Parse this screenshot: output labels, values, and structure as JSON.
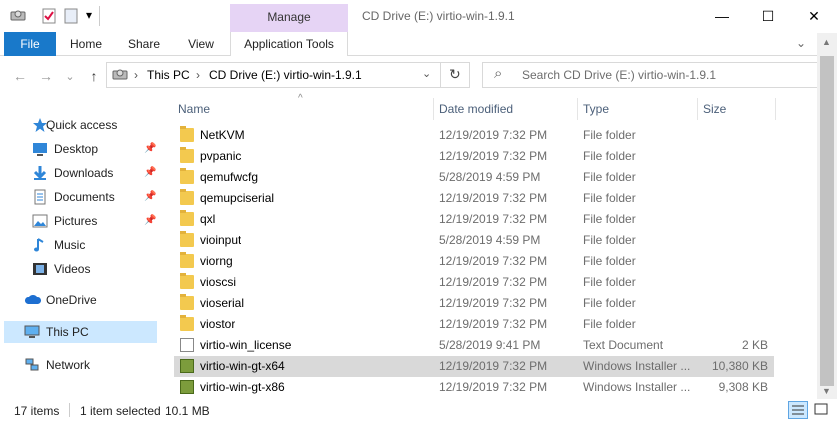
{
  "window": {
    "title": "CD Drive (E:) virtio-win-1.9.1",
    "controls": {
      "minimize": "—",
      "maximize": "☐",
      "close": "✕"
    }
  },
  "quick_access_toolbar": {
    "dropdown_glyph": "▾"
  },
  "ribbon": {
    "context_group_label": "Manage",
    "tabs": [
      "File",
      "Home",
      "Share",
      "View",
      "Application Tools"
    ],
    "expand_icon": "⌄",
    "help_icon": "?"
  },
  "address_bar": {
    "segments": [
      "This PC",
      "CD Drive (E:) virtio-win-1.9.1"
    ],
    "refresh_icon": "↻",
    "dropdown_icon": "⌄"
  },
  "nav_buttons": {
    "back": "←",
    "forward": "→",
    "recent": "⌄",
    "up": "↑"
  },
  "search": {
    "placeholder": "Search CD Drive (E:) virtio-win-1.9.1",
    "icon": "⌕"
  },
  "nav_pane": {
    "items": [
      {
        "label": "Quick access",
        "icon": "star-icon",
        "pinned": false
      },
      {
        "label": "Desktop",
        "icon": "desktop-icon",
        "pinned": true
      },
      {
        "label": "Downloads",
        "icon": "download-icon",
        "pinned": true
      },
      {
        "label": "Documents",
        "icon": "documents-icon",
        "pinned": true
      },
      {
        "label": "Pictures",
        "icon": "pictures-icon",
        "pinned": true
      },
      {
        "label": "Music",
        "icon": "music-icon",
        "pinned": false
      },
      {
        "label": "Videos",
        "icon": "videos-icon",
        "pinned": false
      },
      {
        "label": "OneDrive",
        "icon": "cloud-icon",
        "pinned": false
      },
      {
        "label": "This PC",
        "icon": "computer-icon",
        "pinned": false,
        "selected": true
      },
      {
        "label": "Network",
        "icon": "network-icon",
        "pinned": false
      }
    ]
  },
  "file_list": {
    "headers": {
      "name": "Name",
      "date": "Date modified",
      "type": "Type",
      "size": "Size"
    },
    "sort_glyph": "^",
    "rows": [
      {
        "name": "NetKVM",
        "date": "12/19/2019 7:32 PM",
        "type": "File folder",
        "size": "",
        "kind": "folder"
      },
      {
        "name": "pvpanic",
        "date": "12/19/2019 7:32 PM",
        "type": "File folder",
        "size": "",
        "kind": "folder"
      },
      {
        "name": "qemufwcfg",
        "date": "5/28/2019 4:59 PM",
        "type": "File folder",
        "size": "",
        "kind": "folder"
      },
      {
        "name": "qemupciserial",
        "date": "12/19/2019 7:32 PM",
        "type": "File folder",
        "size": "",
        "kind": "folder"
      },
      {
        "name": "qxl",
        "date": "12/19/2019 7:32 PM",
        "type": "File folder",
        "size": "",
        "kind": "folder"
      },
      {
        "name": "vioinput",
        "date": "5/28/2019 4:59 PM",
        "type": "File folder",
        "size": "",
        "kind": "folder"
      },
      {
        "name": "viorng",
        "date": "12/19/2019 7:32 PM",
        "type": "File folder",
        "size": "",
        "kind": "folder"
      },
      {
        "name": "vioscsi",
        "date": "12/19/2019 7:32 PM",
        "type": "File folder",
        "size": "",
        "kind": "folder"
      },
      {
        "name": "vioserial",
        "date": "12/19/2019 7:32 PM",
        "type": "File folder",
        "size": "",
        "kind": "folder"
      },
      {
        "name": "viostor",
        "date": "12/19/2019 7:32 PM",
        "type": "File folder",
        "size": "",
        "kind": "folder"
      },
      {
        "name": "virtio-win_license",
        "date": "5/28/2019 9:41 PM",
        "type": "Text Document",
        "size": "2 KB",
        "kind": "doc"
      },
      {
        "name": "virtio-win-gt-x64",
        "date": "12/19/2019 7:32 PM",
        "type": "Windows Installer ...",
        "size": "10,380 KB",
        "kind": "msi",
        "selected": true
      },
      {
        "name": "virtio-win-gt-x86",
        "date": "12/19/2019 7:32 PM",
        "type": "Windows Installer ...",
        "size": "9,308 KB",
        "kind": "msi"
      }
    ]
  },
  "status_bar": {
    "item_count": "17 items",
    "selection": "1 item selected",
    "selection_size": "10.1 MB"
  },
  "colors": {
    "accent": "#1979ca",
    "manage_tab": "#e6d4f5",
    "selection": "#cce8ff",
    "row_selected": "#d9d9d9"
  }
}
